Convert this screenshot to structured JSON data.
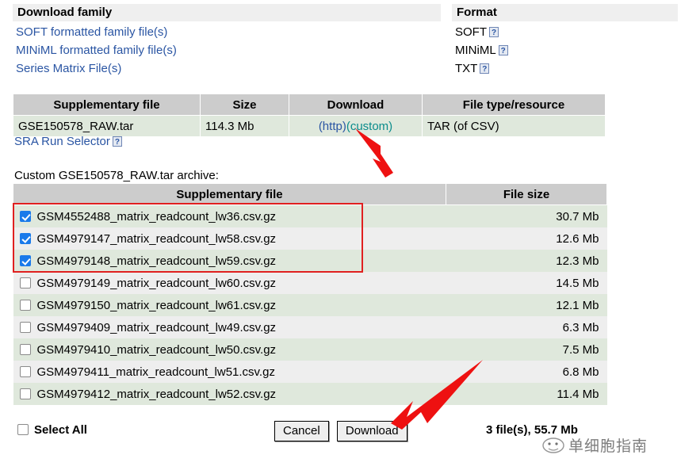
{
  "download_family": {
    "header": "Download family",
    "links": [
      "SOFT formatted family file(s)",
      "MINiML formatted family file(s)",
      "Series Matrix File(s)"
    ]
  },
  "format": {
    "header": "Format",
    "values": [
      "SOFT",
      "MINiML",
      "TXT"
    ],
    "help_icon": "?"
  },
  "supplementary_table": {
    "columns": [
      "Supplementary file",
      "Size",
      "Download",
      "File type/resource"
    ],
    "rows": [
      {
        "file": "GSE150578_RAW.tar",
        "size": "114.3 Mb",
        "download_http": "(http)",
        "download_custom": "(custom)",
        "type": "TAR (of CSV)"
      }
    ],
    "sra_link": "SRA Run Selector"
  },
  "custom_archive": {
    "label": "Custom GSE150578_RAW.tar archive:",
    "columns": [
      "Supplementary file",
      "File size"
    ],
    "files": [
      {
        "name": "GSM4552488_matrix_readcount_lw36.csv.gz",
        "size": "30.7 Mb",
        "checked": true
      },
      {
        "name": "GSM4979147_matrix_readcount_lw58.csv.gz",
        "size": "12.6 Mb",
        "checked": true
      },
      {
        "name": "GSM4979148_matrix_readcount_lw59.csv.gz",
        "size": "12.3 Mb",
        "checked": true
      },
      {
        "name": "GSM4979149_matrix_readcount_lw60.csv.gz",
        "size": "14.5 Mb",
        "checked": false
      },
      {
        "name": "GSM4979150_matrix_readcount_lw61.csv.gz",
        "size": "12.1 Mb",
        "checked": false
      },
      {
        "name": "GSM4979409_matrix_readcount_lw49.csv.gz",
        "size": "6.3 Mb",
        "checked": false
      },
      {
        "name": "GSM4979410_matrix_readcount_lw50.csv.gz",
        "size": "7.5 Mb",
        "checked": false
      },
      {
        "name": "GSM4979411_matrix_readcount_lw51.csv.gz",
        "size": "6.8 Mb",
        "checked": false
      },
      {
        "name": "GSM4979412_matrix_readcount_lw52.csv.gz",
        "size": "11.4 Mb",
        "checked": false
      }
    ]
  },
  "footer": {
    "select_all": "Select All",
    "cancel": "Cancel",
    "download": "Download",
    "total": "3 file(s), 55.7 Mb"
  },
  "annotations": {
    "arrow_color": "#ee1111",
    "arrow_custom_target": "(custom)",
    "arrow_download_target": "Download"
  },
  "watermark": {
    "text": "单细胞指南"
  },
  "colors": {
    "header_gray": "#cccccc",
    "row_green": "#dfe8dc",
    "row_gray": "#eeeeee",
    "link_blue": "#2a55a3",
    "link_teal": "#0b8c8c",
    "highlight_red": "#e02020",
    "checkbox_blue": "#1a7aea"
  }
}
